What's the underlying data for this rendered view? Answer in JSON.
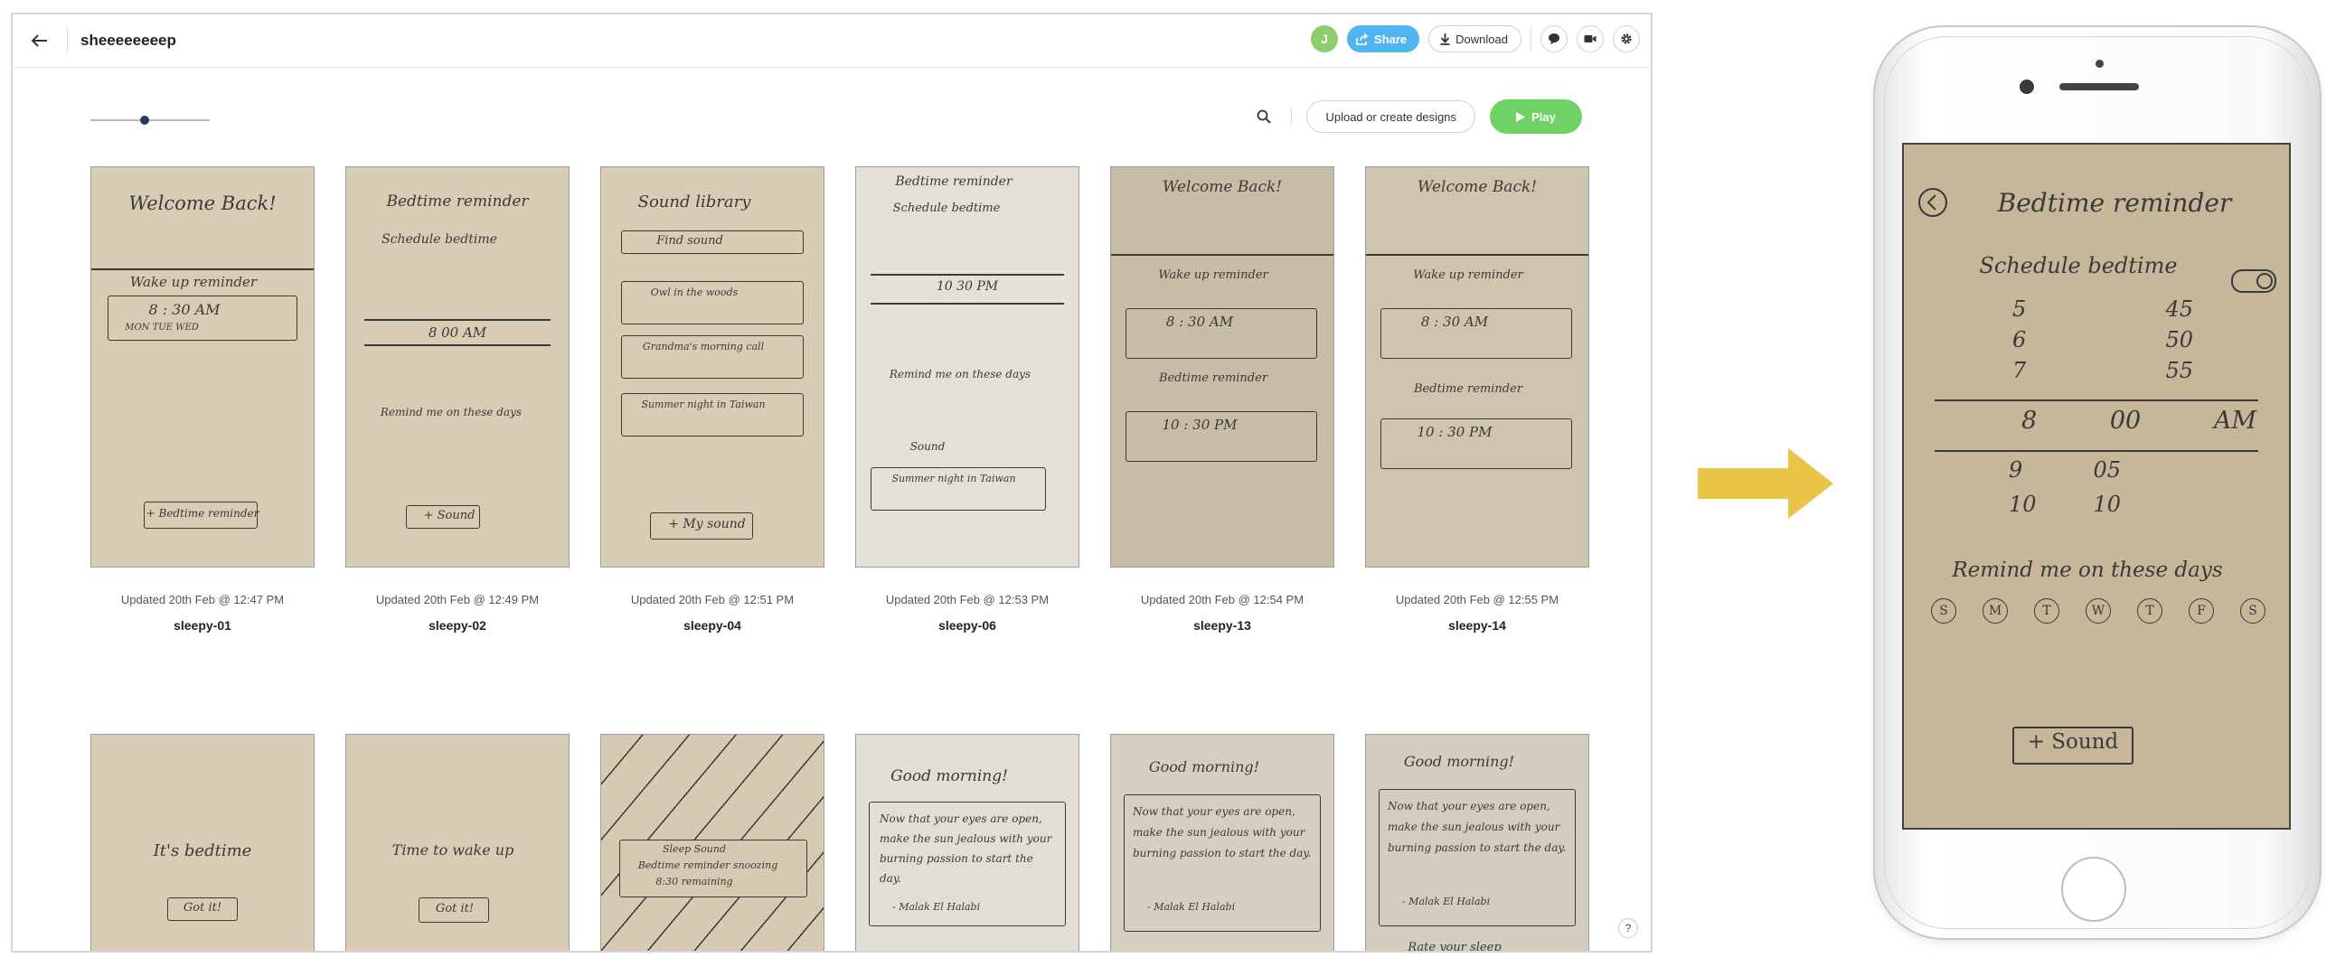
{
  "header": {
    "back_icon": "arrow-left-icon",
    "title": "sheeeeeeeep",
    "avatar_initial": "J",
    "share_label": "Share",
    "download_label": "Download",
    "icons": [
      "comment-icon",
      "video-icon",
      "gear-icon"
    ]
  },
  "toolbar": {
    "zoom_level": 0.45,
    "search_icon": "search-icon",
    "upload_label": "Upload or create designs",
    "play_label": "Play"
  },
  "colors": {
    "share": "#4fb4ef",
    "play": "#6ed364",
    "avatar": "#8fce6e",
    "arrow": "#e8c447",
    "paper": "#d8cdb4"
  },
  "screens_row1": [
    {
      "updated": "Updated 20th Feb @ 12:47 PM",
      "name": "sleepy-01"
    },
    {
      "updated": "Updated 20th Feb @ 12:49 PM",
      "name": "sleepy-02"
    },
    {
      "updated": "Updated 20th Feb @ 12:51 PM",
      "name": "sleepy-04"
    },
    {
      "updated": "Updated 20th Feb @ 12:53 PM",
      "name": "sleepy-06"
    },
    {
      "updated": "Updated 20th Feb @ 12:54 PM",
      "name": "sleepy-13"
    },
    {
      "updated": "Updated 20th Feb @ 12:55 PM",
      "name": "sleepy-14"
    }
  ],
  "sketches": {
    "s01": {
      "title": "Welcome Back!",
      "wake": "Wake up reminder",
      "time": "8 : 30 AM",
      "days": "MON TUE WED",
      "button": "+ Bedtime reminder"
    },
    "s02": {
      "title": "Bedtime reminder",
      "schedule": "Schedule bedtime",
      "selected": "8   00   AM",
      "remind": "Remind me on these days",
      "button": "+ Sound"
    },
    "s04": {
      "title": "Sound library",
      "search": "Find sound",
      "items": [
        "Owl in the woods",
        "Grandma's morning call",
        "Summer night in Taiwan"
      ],
      "button": "+ My sound"
    },
    "s06": {
      "title": "Bedtime reminder",
      "schedule": "Schedule bedtime",
      "selected": "10   30   PM",
      "remind": "Remind me on these days",
      "sound": "Sound",
      "item": "Summer night in Taiwan"
    },
    "s13": {
      "title": "Welcome Back!",
      "wake": "Wake up reminder",
      "time": "8 : 30 AM",
      "bed": "Bedtime reminder",
      "bedtime": "10 : 30 PM"
    },
    "s14": {
      "title": "Welcome Back!",
      "wake": "Wake up reminder",
      "time": "8 : 30 AM",
      "bed": "Bedtime reminder",
      "bedtime": "10 : 30 PM"
    },
    "r2a": {
      "title": "It's bedtime",
      "button": "Got it!"
    },
    "r2b": {
      "title": "Time to wake up",
      "button": "Got it!"
    },
    "r2c": {
      "title": "Sleep Sound",
      "sub": "Bedtime reminder snoozing",
      "time": "8:30 remaining"
    },
    "r2d": {
      "title": "Good morning!",
      "quote": "Now that your eyes are open, make the sun jealous with your burning passion to start the day.",
      "author": "- Malak El Halabi"
    },
    "r2e": {
      "title": "Good morning!",
      "quote": "Now that your eyes are open, make the sun jealous with your burning passion to start the day.",
      "author": "- Malak El Halabi"
    },
    "r2f": {
      "title": "Good morning!",
      "quote": "Now that your eyes are open, make the sun jealous with your burning passion to start the day.",
      "author": "- Malak El Halabi",
      "footer": "Rate your sleep"
    }
  },
  "phone": {
    "title": "Bedtime reminder",
    "schedule": "Schedule bedtime",
    "rows": [
      [
        "5",
        "45"
      ],
      [
        "6",
        "50"
      ],
      [
        "7",
        "55"
      ]
    ],
    "selected": [
      "8",
      "00",
      "AM"
    ],
    "rows_after": [
      [
        "9",
        "05"
      ],
      [
        "10",
        "10"
      ]
    ],
    "remind": "Remind me on these days",
    "days": [
      "S",
      "M",
      "T",
      "W",
      "T",
      "F",
      "S"
    ],
    "button": "+ Sound"
  },
  "help_label": "?"
}
